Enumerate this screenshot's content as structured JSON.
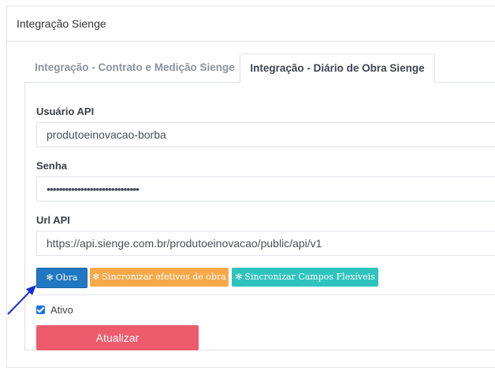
{
  "panel": {
    "title": "Integração Sienge"
  },
  "tabs": [
    {
      "label": "Integração - Contrato e Medição Sienge",
      "active": false
    },
    {
      "label": "Integração - Diário de Obra Sienge",
      "active": true
    }
  ],
  "form": {
    "user_label": "Usuário API",
    "user_value": "produtoeinovacao-borba",
    "password_label": "Senha",
    "password_value": "••••••••••••••••••••••••••••••",
    "url_label": "Url API",
    "url_value": "https://api.sienge.com.br/produtoeinovacao/public/api/v1"
  },
  "buttons": {
    "obra": "Obra",
    "sync_efetivos": "Sincronizar efetivos de obra",
    "sync_campos": "Sincronizar Campos Flexíveis",
    "update": "Atualizar"
  },
  "checkbox": {
    "label": "Ativo",
    "checked": true
  },
  "icons": {
    "gear": "gear-icon",
    "arrow": "arrow-annotation-icon"
  },
  "colors": {
    "blue": "#1f78c1",
    "orange": "#f7a94a",
    "teal": "#2fc3bd",
    "red": "#ee5b6c",
    "annotation_arrow": "#1a2bd8"
  }
}
